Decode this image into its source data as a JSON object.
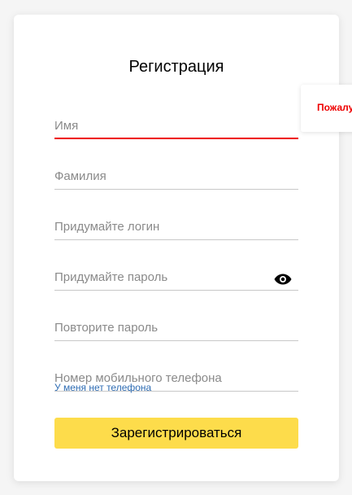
{
  "form": {
    "title": "Регистрация",
    "first_name": {
      "placeholder": "Имя",
      "value": ""
    },
    "last_name": {
      "placeholder": "Фамилия",
      "value": ""
    },
    "login": {
      "placeholder": "Придумайте логин",
      "value": ""
    },
    "password": {
      "placeholder": "Придумайте пароль",
      "value": ""
    },
    "password_repeat": {
      "placeholder": "Повторите пароль",
      "value": ""
    },
    "phone": {
      "placeholder": "Номер мобильного телефона",
      "value": ""
    },
    "no_phone_link": "У меня нет телефона",
    "submit_label": "Зарегистрироваться"
  },
  "tooltip": {
    "text": "Пожалу"
  },
  "icons": {
    "password_toggle": "eye-icon"
  },
  "colors": {
    "accent_button": "#fddc4b",
    "error": "#ee0000",
    "link": "#2f6db4"
  }
}
